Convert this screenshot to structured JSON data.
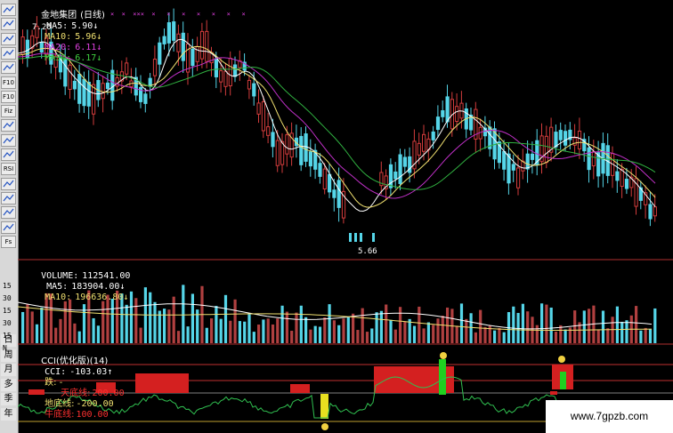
{
  "price_panel": {
    "stock_name": "金地集团",
    "period": "(日线)",
    "ma5_label": "MA5:",
    "ma5_value": "5.90↓",
    "ma10_label": "MA10:",
    "ma10_value": "5.96↓",
    "ma20_label": "MA20:",
    "ma20_value": "6.11↓",
    "ma30_label": "MA30:",
    "ma30_value": "6.17↓",
    "high_label": "7.20",
    "low_label": "5.66",
    "markers": "×  ×  ×××  ×   ×   ×   ×   ×   ×   ×"
  },
  "volume_panel": {
    "volume_label": "VOLUME:",
    "volume_value": "112541.00",
    "ma5_label": "MA5:",
    "ma5_value": "183904.00↓",
    "ma10_label": "MA10:",
    "ma10_value": "196636.80↓",
    "axis": [
      "15",
      "30",
      "15",
      "30",
      "15",
      "N"
    ]
  },
  "cci_panel": {
    "title": "CCI(优化版)(14)",
    "cci_label": "CCI:",
    "cci_value": "-103.03↑",
    "fall_label": "跌:",
    "fall_value": "-",
    "sky_label": "天底线:",
    "sky_value": "200.00",
    "ground_label": "地底线:",
    "ground_value": "-200.00",
    "bull_label": "牛底线:",
    "bull_value": "100.00"
  },
  "toolbar": {
    "icons": [
      "line-icon",
      "kline-icon",
      "bar-icon",
      "chart-icon",
      "chart-icon",
      "fib-icon",
      "f10-icon",
      "fiz-icon",
      "ang-icon",
      "circle-icon",
      "grid-icon",
      "rsi-icon",
      "cross-icon",
      "move-icon",
      "arrow-icon",
      "edit-icon",
      "fs-icon"
    ],
    "icon_labels": [
      "",
      "",
      "",
      "",
      "",
      "F10",
      "F10",
      "Fiz",
      "",
      "",
      "",
      "RSI",
      "",
      "",
      "",
      "",
      "Fs"
    ],
    "period_buttons": [
      "日",
      "周",
      "月",
      "多",
      "季",
      "年"
    ]
  },
  "watermark": "www.7gpzb.com",
  "colors": {
    "up": "#d23c3c",
    "down": "#55d5e8",
    "ma5": "#ffffff",
    "ma10": "#f0e070",
    "ma20": "#c030c8",
    "ma30": "#30b040",
    "cci": "#30c050"
  }
}
